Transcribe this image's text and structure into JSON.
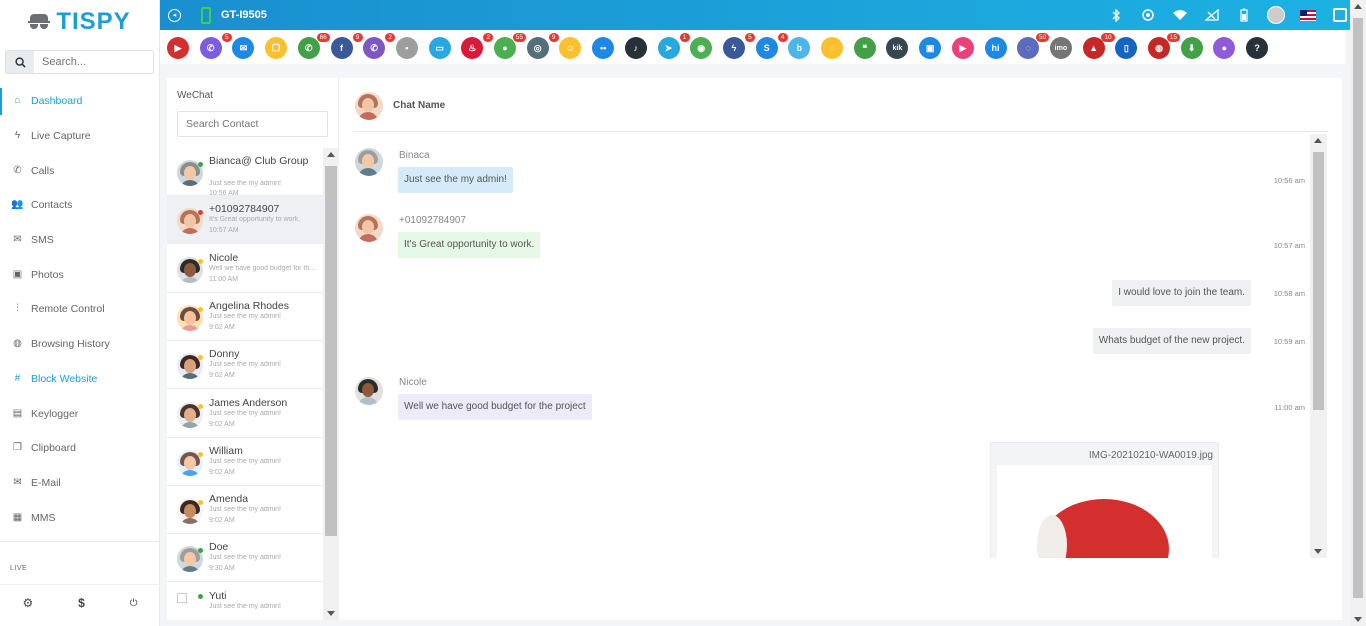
{
  "brand": {
    "name": "TISPY"
  },
  "sidebar": {
    "search_placeholder": "Search...",
    "items": [
      {
        "label": "Dashboard",
        "icon": "home-icon",
        "glyph": "⌂"
      },
      {
        "label": "Live Capture",
        "icon": "bolt-icon",
        "glyph": "ϟ"
      },
      {
        "label": "Calls",
        "icon": "phone-icon",
        "glyph": "✆"
      },
      {
        "label": "Contacts",
        "icon": "users-icon",
        "glyph": "👥"
      },
      {
        "label": "SMS",
        "icon": "mail-icon",
        "glyph": "✉"
      },
      {
        "label": "Photos",
        "icon": "image-icon",
        "glyph": "▣"
      },
      {
        "label": "Remote Control",
        "icon": "sliders-icon",
        "glyph": "⫶"
      },
      {
        "label": "Browsing History",
        "icon": "globe-icon",
        "glyph": "◍"
      },
      {
        "label": "Block Website",
        "icon": "hash-icon",
        "glyph": "#"
      },
      {
        "label": "Keylogger",
        "icon": "clipboard-icon",
        "glyph": "▤"
      },
      {
        "label": "Clipboard",
        "icon": "copy-icon",
        "glyph": "❐"
      },
      {
        "label": "E-Mail",
        "icon": "inbox-icon",
        "glyph": "✉"
      },
      {
        "label": "MMS",
        "icon": "film-icon",
        "glyph": "▦"
      }
    ],
    "live_label": "LIVE",
    "bottom": {
      "settings": "⚙",
      "billing": "$",
      "power": "⏻"
    }
  },
  "topbar": {
    "device_name": "GT-I9505",
    "status_icons": [
      "bluetooth-icon",
      "location-icon",
      "wifi-icon",
      "signal-icon",
      "battery-icon"
    ]
  },
  "apps": [
    {
      "name": "youtube",
      "color": "#d32f2f",
      "glyph": "▶",
      "badge": ""
    },
    {
      "name": "calls",
      "color": "#7c5ce0",
      "glyph": "✆",
      "badge": "5"
    },
    {
      "name": "email",
      "color": "#1e88e5",
      "glyph": "✉",
      "badge": ""
    },
    {
      "name": "clipboard",
      "color": "#fbc02d",
      "glyph": "❐",
      "badge": ""
    },
    {
      "name": "whatsapp",
      "color": "#43a047",
      "glyph": "✆",
      "badge": "66"
    },
    {
      "name": "facebook",
      "color": "#3b5998",
      "glyph": "f",
      "badge": "9"
    },
    {
      "name": "viber",
      "color": "#7e57c2",
      "glyph": "✆",
      "badge": "2"
    },
    {
      "name": "files",
      "color": "#9e9e9e",
      "glyph": "▪",
      "badge": ""
    },
    {
      "name": "screen",
      "color": "#29a7e1",
      "glyph": "▭",
      "badge": ""
    },
    {
      "name": "tinder",
      "color": "#d81b3c",
      "glyph": "♨",
      "badge": "2"
    },
    {
      "name": "wechat",
      "color": "#4caf50",
      "glyph": "●",
      "badge": "55"
    },
    {
      "name": "instagram",
      "color": "#546e7a",
      "glyph": "◎",
      "badge": "9"
    },
    {
      "name": "snapchat",
      "color": "#fbc02d",
      "glyph": "☺",
      "badge": ""
    },
    {
      "name": "flickr",
      "color": "#1e88e5",
      "glyph": "••",
      "badge": ""
    },
    {
      "name": "tiktok",
      "color": "#263238",
      "glyph": "♪",
      "badge": ""
    },
    {
      "name": "telegram",
      "color": "#29a7e1",
      "glyph": "➤",
      "badge": "1"
    },
    {
      "name": "line",
      "color": "#4caf50",
      "glyph": "◉",
      "badge": ""
    },
    {
      "name": "messenger",
      "color": "#3b5998",
      "glyph": "ϟ",
      "badge": "5"
    },
    {
      "name": "skype",
      "color": "#1e88e5",
      "glyph": "S",
      "badge": "4"
    },
    {
      "name": "bip",
      "color": "#4db6e8",
      "glyph": "b",
      "badge": ""
    },
    {
      "name": "talk",
      "color": "#fbc02d",
      "glyph": "◌",
      "badge": ""
    },
    {
      "name": "hangouts",
      "color": "#43a047",
      "glyph": "❝",
      "badge": ""
    },
    {
      "name": "kik",
      "color": "#37474f",
      "glyph": "kik",
      "badge": ""
    },
    {
      "name": "gallery",
      "color": "#1e88e5",
      "glyph": "▣",
      "badge": ""
    },
    {
      "name": "video",
      "color": "#ec407a",
      "glyph": "▶",
      "badge": ""
    },
    {
      "name": "hi",
      "color": "#1e88e5",
      "glyph": "hi",
      "badge": ""
    },
    {
      "name": "signal",
      "color": "#5c6bc0",
      "glyph": "◌",
      "badge": "50"
    },
    {
      "name": "imo",
      "color": "#757575",
      "glyph": "imo",
      "badge": ""
    },
    {
      "name": "photos",
      "color": "#c62828",
      "glyph": "▲",
      "badge": "10"
    },
    {
      "name": "device",
      "color": "#1565c0",
      "glyph": "▯",
      "badge": ""
    },
    {
      "name": "browser",
      "color": "#c62828",
      "glyph": "◍",
      "badge": "15"
    },
    {
      "name": "download",
      "color": "#43a047",
      "glyph": "⬇",
      "badge": ""
    },
    {
      "name": "maps",
      "color": "#8e5cd9",
      "glyph": "●",
      "badge": ""
    },
    {
      "name": "help",
      "color": "#263238",
      "glyph": "?",
      "badge": ""
    }
  ],
  "contacts": {
    "title": "WeChat",
    "search_placeholder": "Search Contact",
    "items": [
      {
        "name": "Bianca@ Club Group",
        "preview": "Just see the my admin!",
        "time": "10:56 AM",
        "status": "#43a047"
      },
      {
        "name": "+01092784907",
        "preview": "It's Great opportunity to work.",
        "time": "10:57 AM",
        "status": "#e53935"
      },
      {
        "name": "Nicole",
        "preview": "Well we have good budget for the project",
        "time": "11:00 AM",
        "status": "#fbc02d"
      },
      {
        "name": "Angelina Rhodes",
        "preview": "Just see the my admin!",
        "time": "9:02 AM",
        "status": "#fbc02d"
      },
      {
        "name": "Donny",
        "preview": "Just see the my admin!",
        "time": "9:02 AM",
        "status": "#fbc02d"
      },
      {
        "name": "James Anderson",
        "preview": "Just see the my admin!",
        "time": "9:02 AM",
        "status": "#fbc02d"
      },
      {
        "name": "William",
        "preview": "Just see the my admin!",
        "time": "9:02 AM",
        "status": "#fbc02d"
      },
      {
        "name": "Amenda",
        "preview": "Just see the my admin!",
        "time": "9:02 AM",
        "status": "#fbc02d"
      },
      {
        "name": "Doe",
        "preview": "Just see the my admin!",
        "time": "9:30 AM",
        "status": "#43a047"
      },
      {
        "name": "Yuti",
        "preview": "Just see the my admin!",
        "time": "",
        "status": "#43a047"
      }
    ]
  },
  "chat": {
    "header_name": "Chat Name",
    "messages": [
      {
        "sender": "Binaca",
        "text": "Just see the my admin!",
        "time": "10:56 am"
      },
      {
        "sender": "+01092784907",
        "text": "It's Great opportunity to work.",
        "time": "10:57 am"
      },
      {
        "sender": "",
        "text": "I would love to join the team.",
        "time": "10:58 am"
      },
      {
        "sender": "",
        "text": "Whats budget of the new project.",
        "time": "10:59 am"
      },
      {
        "sender": "Nicole",
        "text": "Well we have good budget for the project",
        "time": "11:00 am"
      }
    ],
    "attachment": {
      "filename": "IMG-20210210-WA0019.jpg"
    }
  }
}
